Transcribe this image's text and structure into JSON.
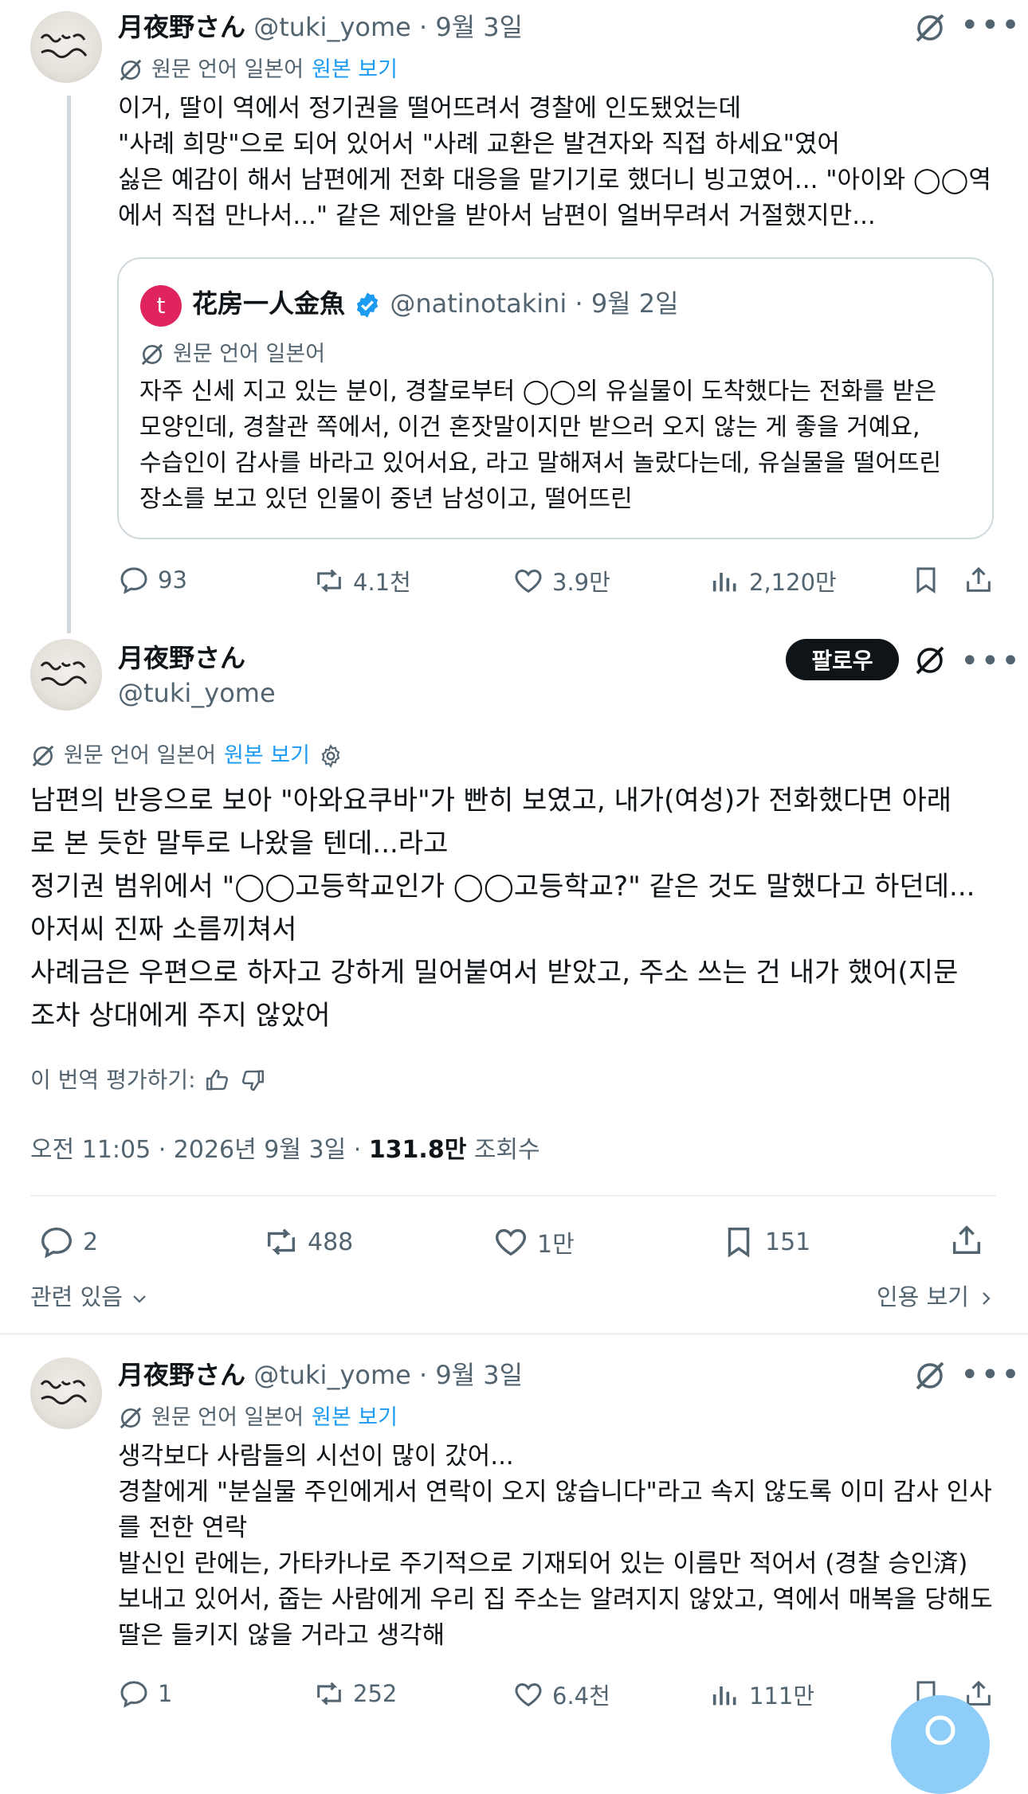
{
  "tweet1": {
    "name": "月夜野さん",
    "handle_date": "@tuki_yome · 9월 3일",
    "translated_from": "원문 언어 일본어",
    "show_original": "원본 보기",
    "text": "이거, 딸이 역에서 정기권을 떨어뜨려서 경찰에 인도됐었는데\n\"사례 희망\"으로 되어 있어서 \"사례 교환은 발견자와 직접 하세요\"였어\n싫은 예감이 해서 남편에게 전화 대응을 맡기기로 했더니 빙고였어... \"아이와 ◯◯역\n에서 직접 만나서...\" 같은 제안을 받아서 남편이 얼버무려서 거절했지만...",
    "quote": {
      "avatar_letter": "t",
      "name": "花房一人金魚",
      "handle_date": "@natinotakini · 9월 2일",
      "translated_from": "원문 언어 일본어",
      "text": "자주 신세 지고 있는 분이, 경찰로부터 ◯◯의 유실물이 도착했다는 전화를 받은\n모양인데, 경찰관 쪽에서, 이건 혼잣말이지만 받으러 오지 않는 게 좋을 거예요,\n수습인이 감사를 바라고 있어서요, 라고 말해져서 놀랐다는데, 유실물을 떨어뜨린\n장소를 보고 있던 인물이 중년 남성이고, 떨어뜨린"
    },
    "stats": {
      "replies": "93",
      "reposts": "4.1천",
      "likes": "3.9만",
      "views": "2,120만"
    }
  },
  "main": {
    "name": "月夜野さん",
    "handle": "@tuki_yome",
    "follow_label": "팔로우",
    "translated_from": "원문 언어 일본어",
    "show_original": "원본 보기",
    "text": "남편의 반응으로 보아 \"아와요쿠바\"가 빤히 보였고, 내가(여성)가 전화했다면 아래\n로 본 듯한 말투로 나왔을 텐데...라고\n정기권 범위에서 \"◯◯고등학교인가 ◯◯고등학교?\" 같은 것도 말했다고 하던데...\n아저씨 진짜 소름끼쳐서\n사례금은 우편으로 하자고 강하게 밀어붙여서 받았고, 주소 쓰는 건 내가 했어(지문\n조차 상대에게 주지 않았어",
    "rate_label": "이 번역 평가하기:",
    "timestamp": "오전 11:05 · 2026년 9월 3일 · ",
    "views_count": "131.8만",
    "views_label": " 조회수",
    "stats": {
      "replies": "2",
      "reposts": "488",
      "likes": "1만",
      "bookmarks": "151"
    },
    "related": "관련 있음",
    "quotes_link": "인용 보기"
  },
  "tweet3": {
    "name": "月夜野さん",
    "handle_date": "@tuki_yome · 9월 3일",
    "translated_from": "원문 언어 일본어",
    "show_original": "원본 보기",
    "text": "생각보다 사람들의 시선이 많이 갔어...\n경찰에게 \"분실물 주인에게서 연락이 오지 않습니다\"라고 속지 않도록 이미 감사 인사\n를 전한 연락\n발신인 란에는, 가타카나로 주기적으로 기재되어 있는 이름만 적어서 (경찰 승인済)\n보내고 있어서, 줍는 사람에게 우리 집 주소는 알려지지 않았고, 역에서 매복을 당해도\n딸은 들키지 않을 거라고 생각해",
    "stats": {
      "replies": "1",
      "reposts": "252",
      "likes": "6.4천",
      "views": "111만"
    }
  },
  "colors": {
    "accent": "#1d9bf0",
    "text": "#0f1419",
    "muted": "#536471",
    "border": "#cfd9de"
  }
}
